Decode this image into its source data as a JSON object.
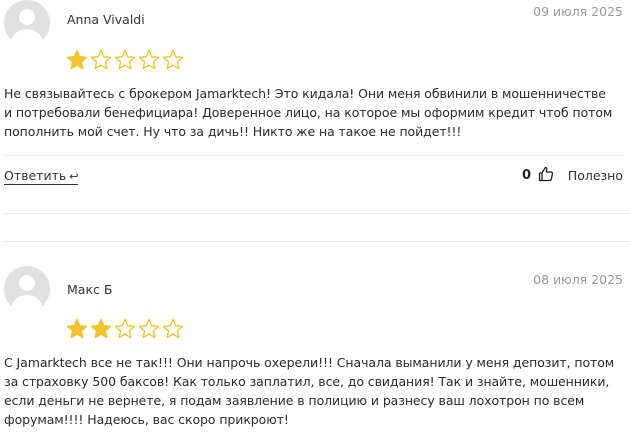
{
  "reviews": [
    {
      "author": "Anna Vivaldi",
      "date": "09 июля 2025",
      "rating": 1,
      "max_rating": 5,
      "text_lines": [
        "Не связывайтесь с брокером Jamarktech! Это кидала! Они меня обвинили в мошенничестве",
        "и потребовали бенефициара! Доверенное лицо, на которое мы оформим кредит чтоб потом",
        "пополнить мой счет. Ну что за дичь!! Никто же на такое не пойдет!!!"
      ],
      "reply_label": "Ответить",
      "likes": "0",
      "useful_label": "Полезно"
    },
    {
      "author": "Макс Б",
      "date": "08 июля 2025",
      "rating": 2,
      "max_rating": 5,
      "text_lines": [
        "С Jamarktech все не так!!! Они напрочь охерели!!! Сначала выманили у меня депозит, потом",
        "за страховку 500 баксов! Как только заплатил, все, до свидания! Так и знайте, мошенники,",
        "если деньги не вернете, я подам заявление в полицию и разнесу ваш лохотрон по всем",
        "форумам!!!! Надеюсь, вас скоро прикроют!"
      ]
    }
  ],
  "colors": {
    "star_filled": "#f2c42c",
    "star_empty_stroke": "#f2c42c",
    "divider": "#ececec",
    "date": "#9a9a9a"
  },
  "icons": {
    "reply": "reply-arrow-icon",
    "like": "thumbs-up-icon",
    "star": "star-icon",
    "avatar": "user-silhouette-icon"
  }
}
